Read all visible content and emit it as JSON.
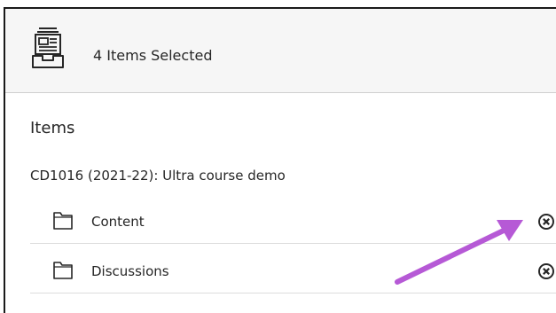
{
  "header": {
    "title": "4 Items Selected",
    "icon": "archive-tray-icon"
  },
  "section": {
    "title": "Items"
  },
  "course": {
    "name": "CD1016 (2021-22): Ultra course demo"
  },
  "items": [
    {
      "label": "Content",
      "icon": "folder-icon",
      "action": "remove-icon"
    },
    {
      "label": "Discussions",
      "icon": "folder-icon",
      "action": "remove-icon"
    }
  ],
  "annotation": {
    "arrow_color": "#b659d6"
  }
}
